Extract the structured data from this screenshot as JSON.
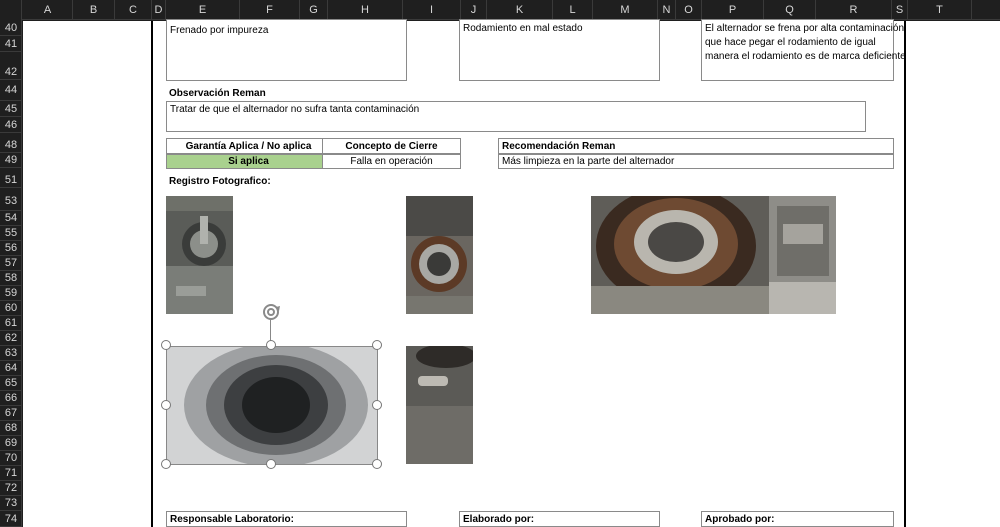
{
  "columns": [
    "A",
    "B",
    "C",
    "D",
    "E",
    "F",
    "G",
    "H",
    "I",
    "J",
    "K",
    "L",
    "M",
    "N",
    "O",
    "P",
    "Q",
    "R",
    "S",
    "T"
  ],
  "rows": [
    "40",
    "41",
    "42",
    "44",
    "45",
    "46",
    "48",
    "49",
    "51",
    "53",
    "54",
    "55",
    "56",
    "57",
    "58",
    "59",
    "60",
    "61",
    "62",
    "63",
    "64",
    "65",
    "66",
    "67",
    "68",
    "69",
    "70",
    "71",
    "72",
    "73",
    "74"
  ],
  "cells": {
    "causa1": "Frenado por impureza",
    "causa2": "Rodamiento en mal estado",
    "causa3_l1": "El alternador se frena por alta contaminación",
    "causa3_l2": "que hace pegar el rodamiento de igual",
    "causa3_l3": "manera el rodamiento es de marca deficiente",
    "obs_title": "Observación Reman",
    "obs_text": "Tratar de que el alternador no sufra tanta contaminación",
    "garantia_title": "Garantía Aplica / No aplica",
    "garantia_value": "Si aplica",
    "concepto_title": "Concepto de Cierre",
    "concepto_value": "Falla en operación",
    "recom_title": "Recomendación Reman",
    "recom_value": "Más limpieza en la parte del alternador",
    "registro_title": "Registro Fotografico:",
    "responsable": "Responsable Laboratorio:",
    "elaborado": "Elaborado por:",
    "aprobado": "Aprobado por:"
  },
  "colors": {
    "green": "#a9d18e",
    "header_bg": "#1f1f1f",
    "header_text": "#d6d6d6"
  }
}
